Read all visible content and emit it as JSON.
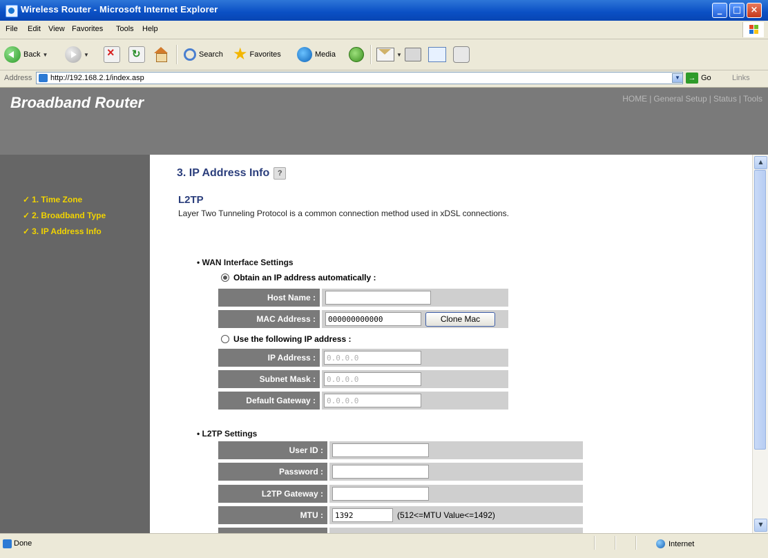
{
  "window": {
    "title": "Wireless Router - Microsoft Internet Explorer"
  },
  "menu": [
    "File",
    "Edit",
    "View",
    "Favorites",
    "Tools",
    "Help"
  ],
  "toolbar": {
    "back": "Back",
    "search": "Search",
    "favorites": "Favorites",
    "media": "Media"
  },
  "address": {
    "label": "Address",
    "url": "http://192.168.2.1/index.asp",
    "go": "Go",
    "links": "Links"
  },
  "router": {
    "brand": "Broadband Router",
    "nav": [
      "HOME",
      "General Setup",
      "Status",
      "Tools"
    ]
  },
  "sidebar": {
    "items": [
      {
        "label": "1. Time Zone"
      },
      {
        "label": "2. Broadband Type"
      },
      {
        "label": "3. IP Address Info"
      }
    ]
  },
  "content": {
    "page_title": "3. IP Address Info",
    "section_title": "L2TP",
    "description": "Layer Two Tunneling Protocol is a common connection method used in xDSL connections.",
    "wan_title": "WAN Interface Settings",
    "obtain_auto": "Obtain an IP address automatically :",
    "use_following": "Use the following IP address :",
    "host_name": {
      "label": "Host Name :",
      "value": ""
    },
    "mac_address": {
      "label": "MAC Address :",
      "value": "000000000000",
      "button": "Clone Mac"
    },
    "ip_address": {
      "label": "IP Address :",
      "value": "0.0.0.0"
    },
    "subnet_mask": {
      "label": "Subnet Mask :",
      "value": "0.0.0.0"
    },
    "default_gateway": {
      "label": "Default Gateway :",
      "value": "0.0.0.0"
    },
    "l2tp_title": "L2TP Settings",
    "user_id": {
      "label": "User ID :",
      "value": ""
    },
    "password": {
      "label": "Password :",
      "value": ""
    },
    "l2tp_gateway": {
      "label": "L2TP Gateway :",
      "value": ""
    },
    "mtu": {
      "label": "MTU :",
      "value": "1392",
      "hint": "(512<=MTU Value<=1492)"
    }
  },
  "status": {
    "text": "Done",
    "zone": "Internet"
  }
}
